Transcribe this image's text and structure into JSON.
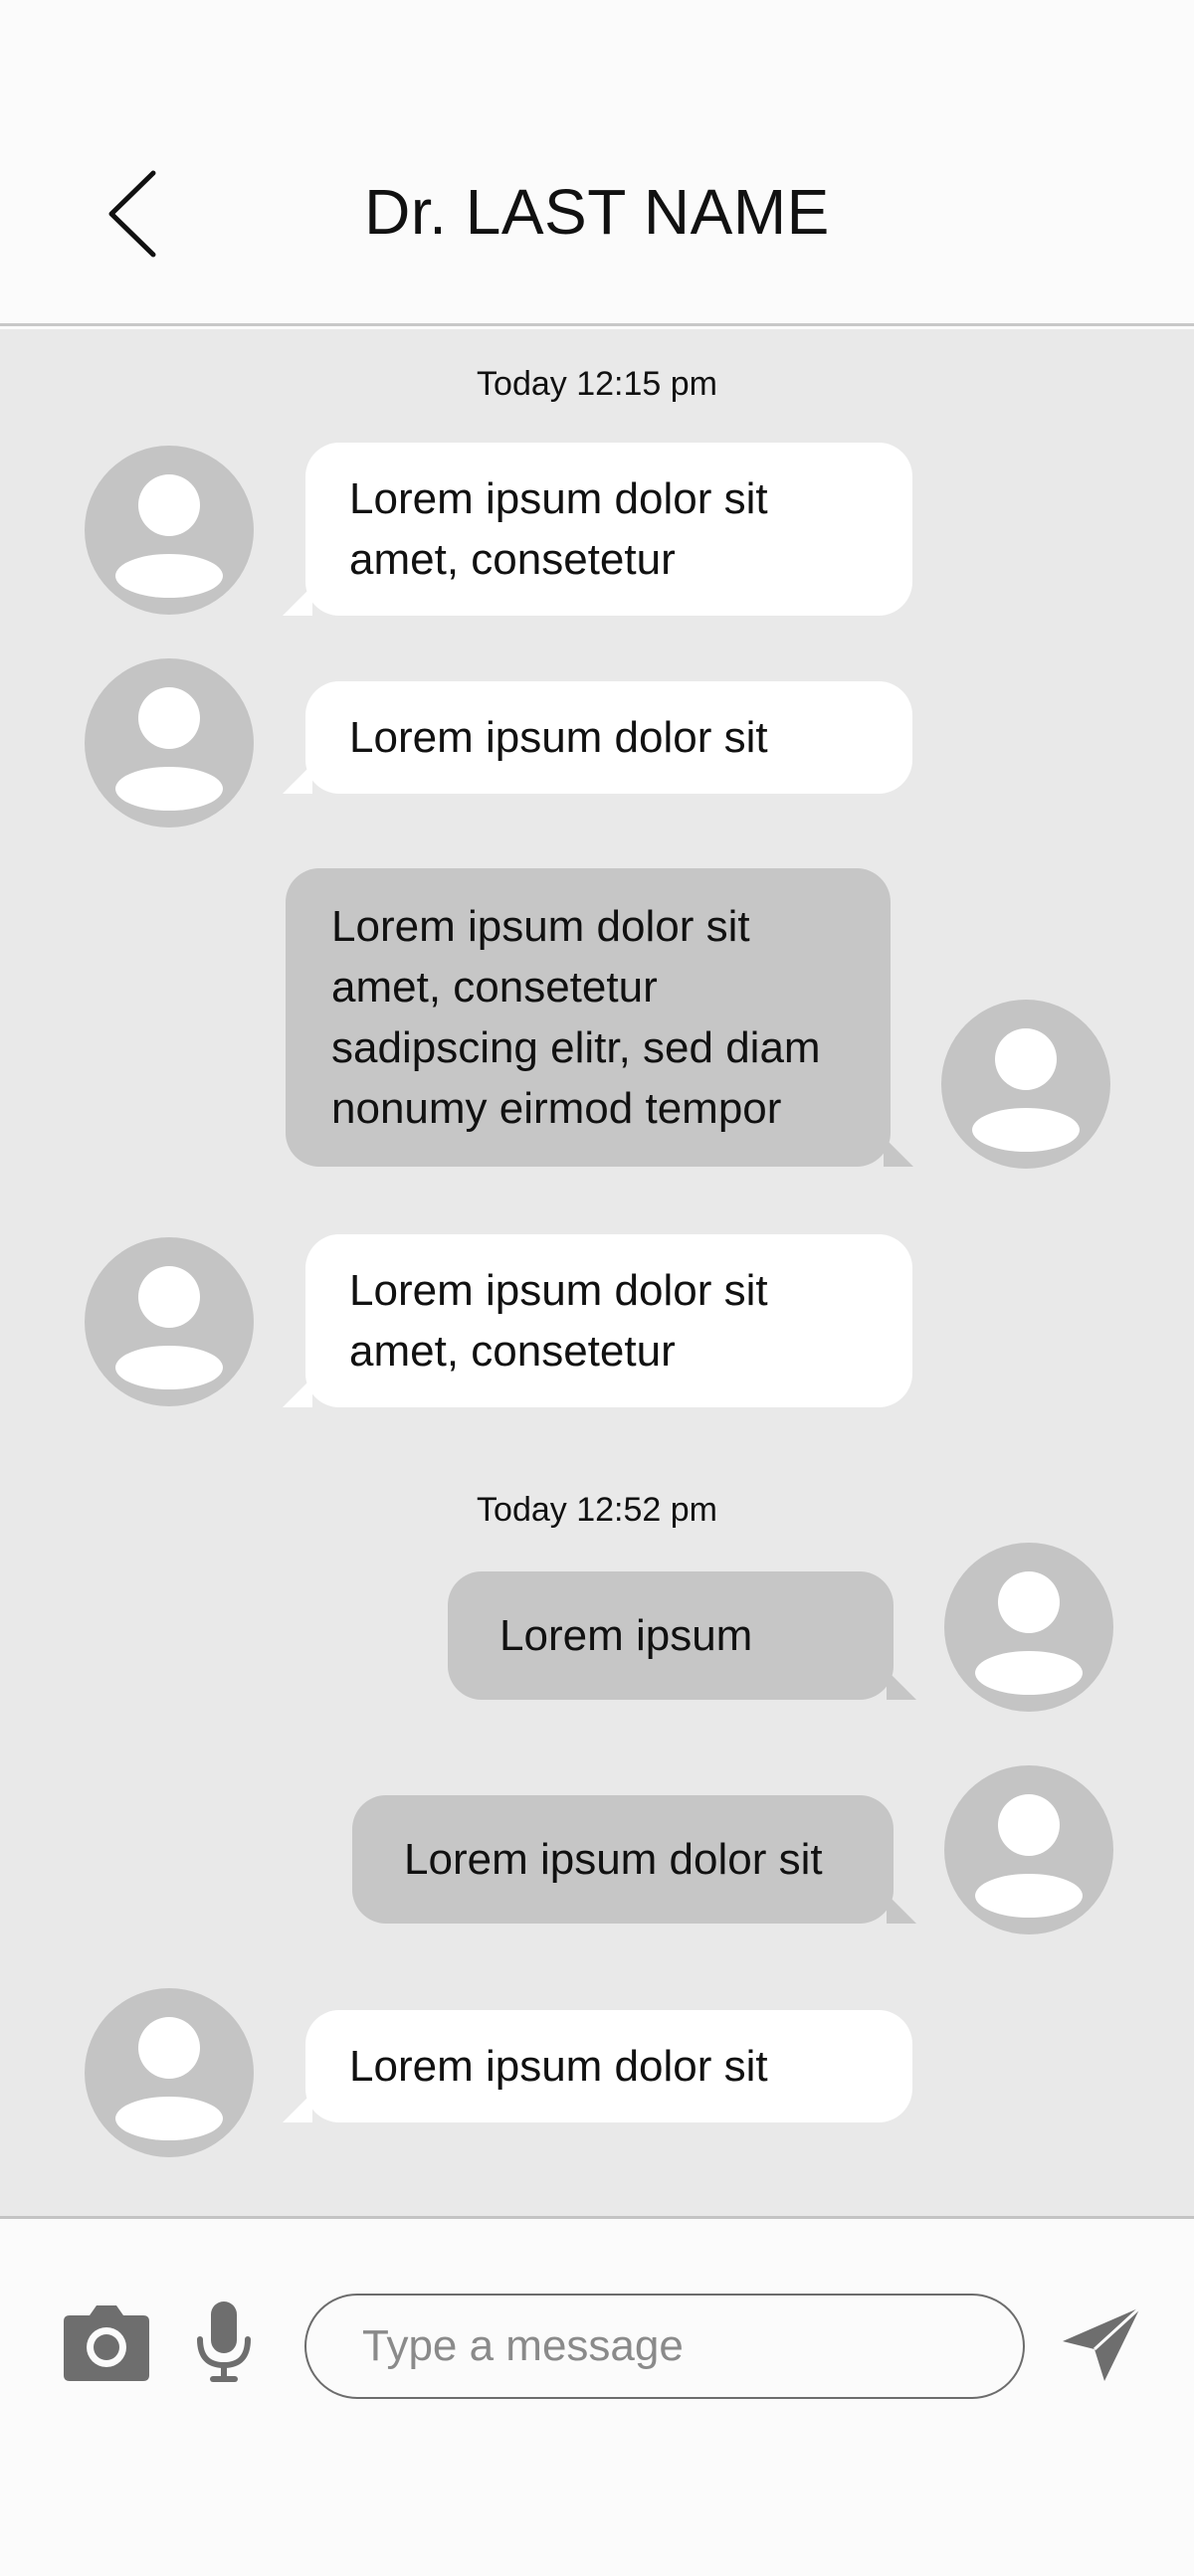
{
  "header": {
    "title": "Dr. LAST NAME",
    "back_icon": "chevron-left-icon"
  },
  "messages": [
    {
      "type": "timestamp",
      "text": "Today 12:15 pm"
    },
    {
      "type": "incoming",
      "text": "Lorem ipsum dolor sit amet, consetetur"
    },
    {
      "type": "incoming",
      "text": "Lorem ipsum dolor sit"
    },
    {
      "type": "outgoing",
      "text": "Lorem ipsum dolor sit amet, consetetur sadipscing elitr, sed diam nonumy eirmod tempor"
    },
    {
      "type": "incoming",
      "text": "Lorem ipsum dolor sit amet, consetetur"
    },
    {
      "type": "timestamp",
      "text": "Today 12:52 pm"
    },
    {
      "type": "outgoing",
      "text": "Lorem ipsum"
    },
    {
      "type": "outgoing",
      "text": "Lorem ipsum dolor sit"
    },
    {
      "type": "incoming",
      "text": "Lorem ipsum dolor sit"
    }
  ],
  "composer": {
    "placeholder": "Type a message",
    "value": "",
    "camera_icon": "camera-icon",
    "mic_icon": "microphone-icon",
    "send_icon": "send-icon"
  },
  "colors": {
    "background": "#fbfbfb",
    "chat_background": "#e9e9e9",
    "incoming_bubble": "#ffffff",
    "outgoing_bubble": "#c6c6c6",
    "avatar": "#c4c4c4",
    "icon": "#6e6e6e"
  }
}
